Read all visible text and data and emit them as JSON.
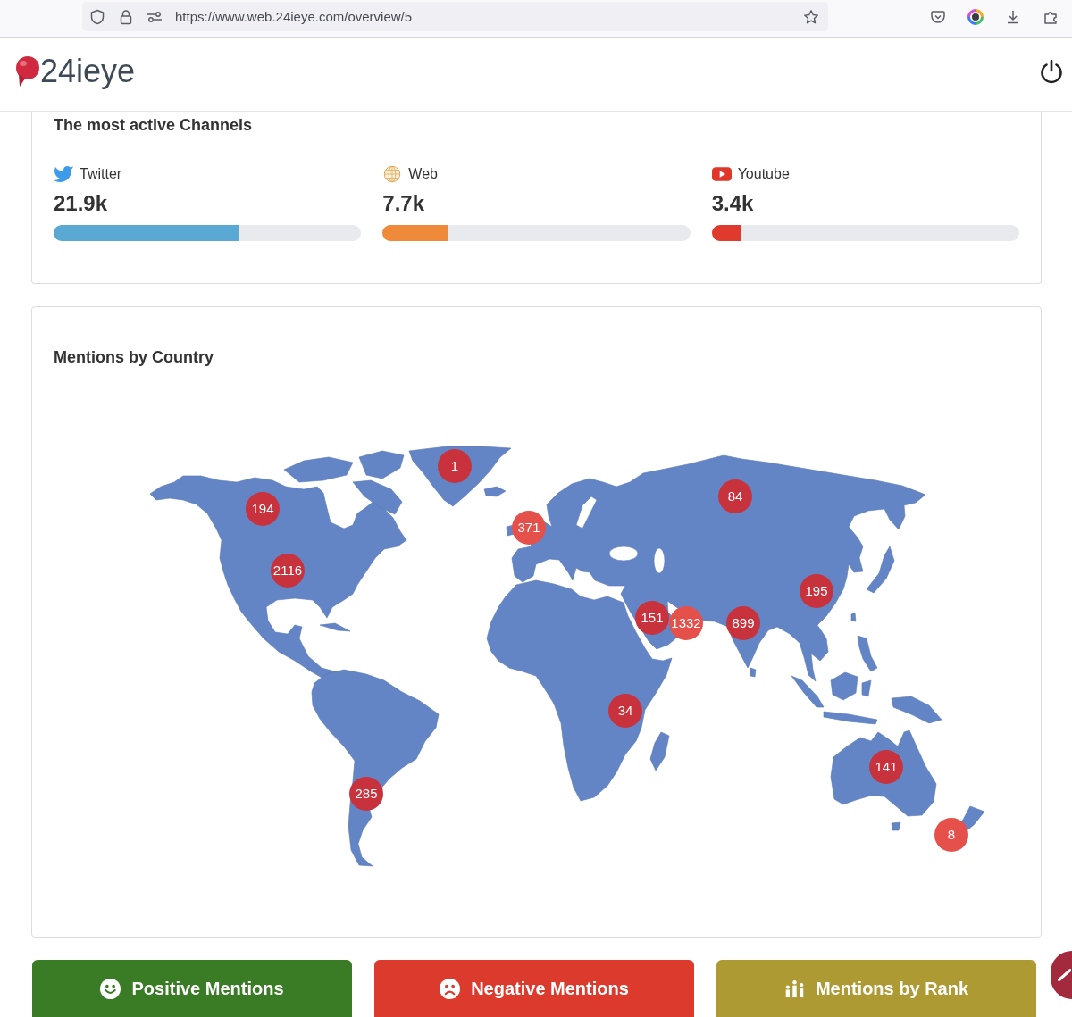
{
  "browser": {
    "url": "https://www.web.24ieye.com/overview/5"
  },
  "header": {
    "logo_text": "24ieye"
  },
  "channels_card": {
    "title": "The most active Channels",
    "channels": [
      {
        "kind": "twitter",
        "name": "Twitter",
        "value": "21.9k",
        "level": 0.6,
        "color": "#5aa9d5"
      },
      {
        "kind": "web",
        "name": "Web",
        "value": "7.7k",
        "level": 0.21,
        "color": "#ee8a3a"
      },
      {
        "kind": "youtube",
        "name": "Youtube",
        "value": "3.4k",
        "level": 0.093,
        "color": "#e0392d"
      }
    ]
  },
  "map_card": {
    "title": "Mentions by Country",
    "markers": [
      {
        "label": "1",
        "color": "#c8323c"
      },
      {
        "label": "84",
        "color": "#c8323c"
      },
      {
        "label": "194",
        "color": "#c8323c"
      },
      {
        "label": "371",
        "color": "#e6504b"
      },
      {
        "label": "2116",
        "color": "#c8323c"
      },
      {
        "label": "195",
        "color": "#c8323c"
      },
      {
        "label": "151",
        "color": "#c8323c"
      },
      {
        "label": "1332",
        "color": "#e6504b"
      },
      {
        "label": "899",
        "color": "#c8323c"
      },
      {
        "label": "34",
        "color": "#c8323c"
      },
      {
        "label": "141",
        "color": "#c8323c"
      },
      {
        "label": "285",
        "color": "#c8323c"
      },
      {
        "label": "8",
        "color": "#e6504b"
      }
    ]
  },
  "actions": [
    {
      "kind": "positive",
      "label": "Positive Mentions",
      "color": "#3a7c25"
    },
    {
      "kind": "negative",
      "label": "Negative Mentions",
      "color": "#dc3a2d"
    },
    {
      "kind": "rank",
      "label": "Mentions by Rank",
      "color": "#ad9a33"
    }
  ]
}
